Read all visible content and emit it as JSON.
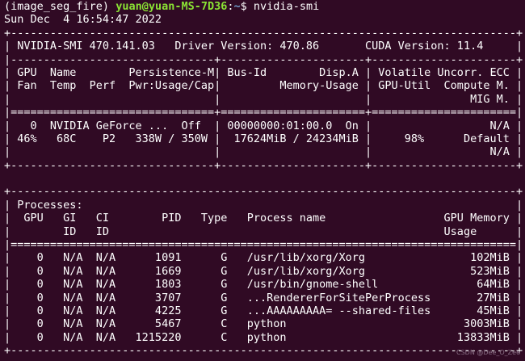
{
  "terminal": {
    "env": "(image_seg_fire)",
    "user_host": "yuan@yuan-MS-7D36",
    "path": "~",
    "prompt_symbol": "$",
    "command": "nvidia-smi"
  },
  "date_line": "Sun Dec  4 16:54:47 2022",
  "smi_lines": [
    "+-----------------------------------------------------------------------------+",
    "| NVIDIA-SMI 470.141.03   Driver Version: 470.86       CUDA Version: 11.4     |",
    "|-------------------------------+----------------------+----------------------+",
    "| GPU  Name        Persistence-M| Bus-Id        Disp.A | Volatile Uncorr. ECC |",
    "| Fan  Temp  Perf  Pwr:Usage/Cap|         Memory-Usage | GPU-Util  Compute M. |",
    "|                               |                      |               MIG M. |",
    "|===============================+======================+======================|",
    "|   0  NVIDIA GeForce ...  Off  | 00000000:01:00.0  On |                  N/A |",
    "| 46%   68C    P2   338W / 350W |  17624MiB / 24234MiB |     98%      Default |",
    "|                               |                      |                  N/A |",
    "+-------------------------------+----------------------+----------------------+",
    "",
    "+-----------------------------------------------------------------------------+",
    "| Processes:                                                                  |",
    "|  GPU   GI   CI        PID   Type   Process name                  GPU Memory |",
    "|        ID   ID                                                   Usage      |",
    "|=============================================================================|",
    "|    0   N/A  N/A      1091      G   /usr/lib/xorg/Xorg                102MiB |",
    "|    0   N/A  N/A      1669      G   /usr/lib/xorg/Xorg                523MiB |",
    "|    0   N/A  N/A      1803      G   /usr/bin/gnome-shell               64MiB |",
    "|    0   N/A  N/A      3707      G   ...RendererForSitePerProcess       27MiB |",
    "|    0   N/A  N/A      4225      G   ...AAAAAAAAA= --shared-files       45MiB |",
    "|    0   N/A  N/A      5467      C   python                           3003MiB |",
    "|    0   N/A  N/A   1215220      C   python                          13833MiB |",
    "+-----------------------------------------------------------------------------+"
  ],
  "watermark": "CSDN @Dee_O_Zee"
}
